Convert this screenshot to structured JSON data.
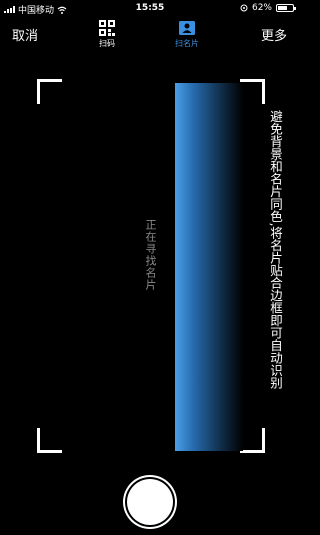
{
  "status_bar": {
    "carrier": "中国移动",
    "time": "15:55",
    "battery_text": "62%",
    "battery_level": 0.62
  },
  "top_bar": {
    "cancel_label": "取消",
    "more_label": "更多",
    "tabs": [
      {
        "label": "扫码",
        "icon": "qr-code-icon",
        "active": false
      },
      {
        "label": "扫名片",
        "icon": "business-card-icon",
        "active": true
      }
    ],
    "active_color": "#3b8fe0"
  },
  "scanner": {
    "status_text": "正在寻找名片",
    "hint_text": "避免背景和名片同色,将名片贴合边框即可自动识别"
  },
  "controls": {
    "shutter_icon": "shutter-button"
  }
}
